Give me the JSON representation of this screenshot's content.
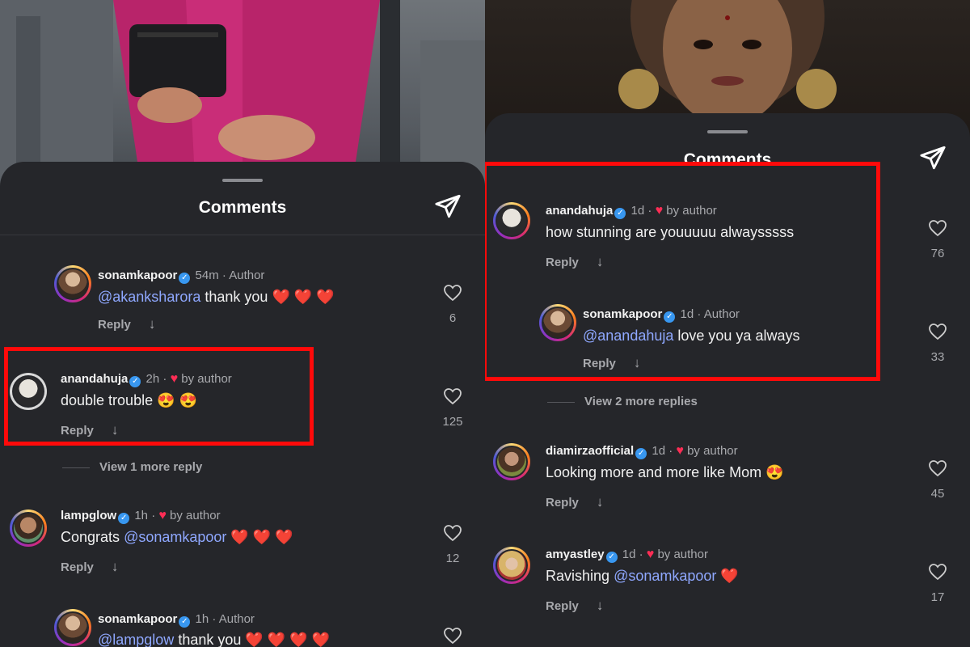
{
  "sheet_title": "Comments",
  "reply_label": "Reply",
  "left": {
    "comments": [
      {
        "username": "sonamkapoor",
        "time": "54m",
        "tag": "Author",
        "mention": "@akanksharora",
        "text": "thank you",
        "emoji": "❤️ ❤️ ❤️",
        "likes": "6"
      },
      {
        "username": "anandahuja",
        "time": "2h",
        "tag": "by author",
        "text": "double trouble",
        "emoji": "😍 😍",
        "likes": "125"
      },
      {
        "username": "lampglow",
        "time": "1h",
        "tag": "by author",
        "prefix": "Congrats",
        "mention": "@sonamkapoor",
        "emoji": "❤️ ❤️ ❤️",
        "likes": "12"
      },
      {
        "username": "sonamkapoor",
        "time": "1h",
        "tag": "Author",
        "mention": "@lampglow",
        "text": "thank you",
        "emoji": "❤️ ❤️ ❤️ ❤️",
        "likes": ""
      }
    ],
    "more_replies": "View 1 more reply"
  },
  "right": {
    "comments": [
      {
        "username": "anandahuja",
        "time": "1d",
        "tag": "by author",
        "text": "how stunning are youuuuu alwaysssss",
        "likes": "76"
      },
      {
        "username": "sonamkapoor",
        "time": "1d",
        "tag": "Author",
        "mention": "@anandahuja",
        "text": "love you ya always",
        "likes": "33"
      },
      {
        "username": "diamirzaofficial",
        "time": "1d",
        "tag": "by author",
        "text": "Looking more and more like Mom",
        "emoji": "😍",
        "likes": "45"
      },
      {
        "username": "amyastley",
        "time": "1d",
        "tag": "by author",
        "text": "Ravishing",
        "mention": "@sonamkapoor",
        "emoji": "❤️",
        "likes": "17"
      }
    ],
    "more_replies": "View 2 more replies"
  },
  "colors": {
    "sheet": "#25262a",
    "highlight": "#ff0a0a",
    "mention": "#8fa8ff",
    "verified": "#3897f0"
  },
  "icons": {
    "send": "send-icon",
    "like": "heart-outline-icon",
    "verified": "verified-badge-icon",
    "author_like": "heart-filled-icon",
    "expand": "arrow-down-icon"
  }
}
